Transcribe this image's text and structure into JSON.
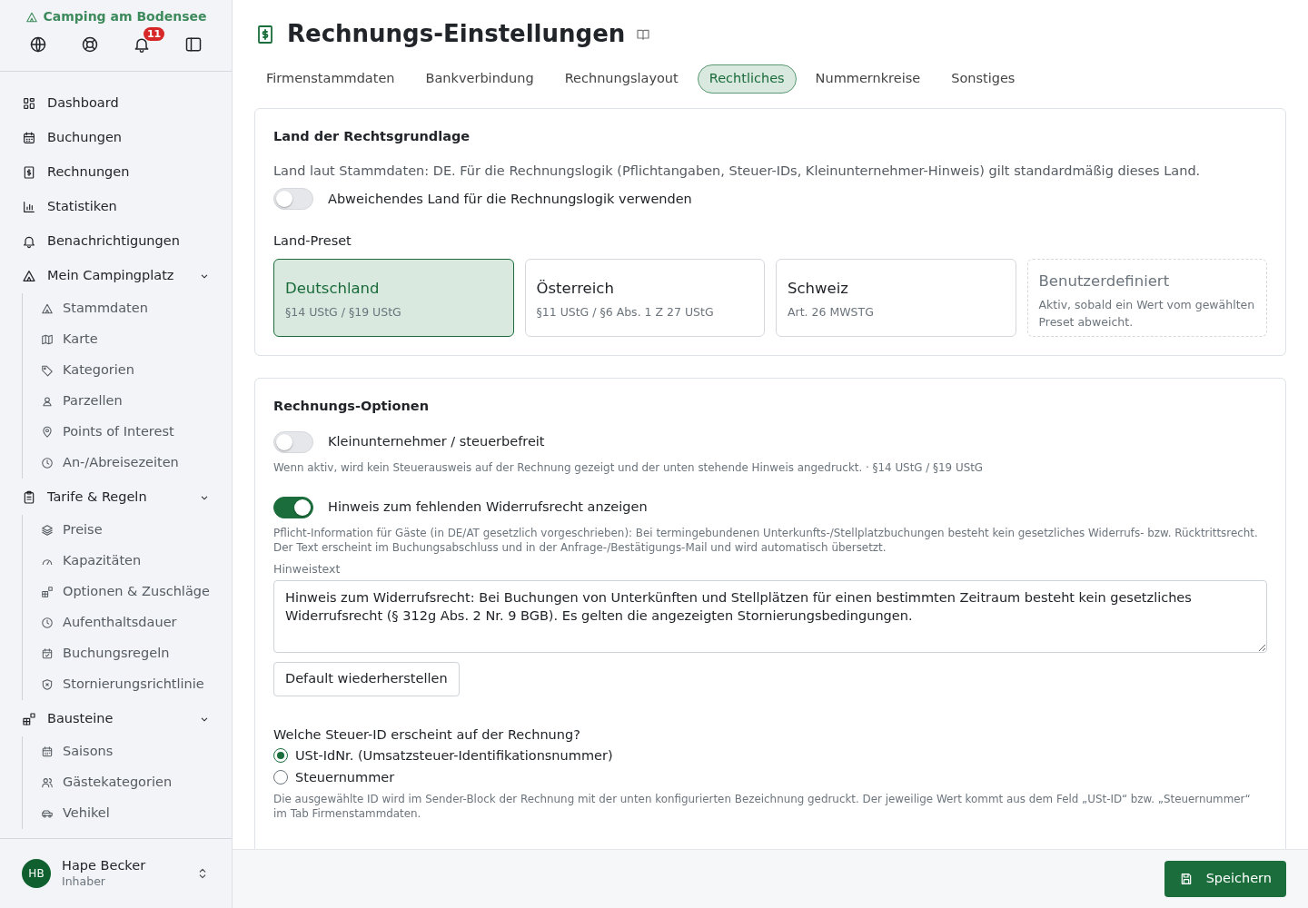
{
  "sidebar": {
    "brand": "Camping am Bodensee",
    "notification_count": "11",
    "items": [
      {
        "label": "Dashboard"
      },
      {
        "label": "Buchungen"
      },
      {
        "label": "Rechnungen"
      },
      {
        "label": "Statistiken"
      },
      {
        "label": "Benachrichtigungen"
      },
      {
        "label": "Mein Campingplatz",
        "expanded": true,
        "children": [
          {
            "label": "Stammdaten"
          },
          {
            "label": "Karte"
          },
          {
            "label": "Kategorien"
          },
          {
            "label": "Parzellen"
          },
          {
            "label": "Points of Interest"
          },
          {
            "label": "An-/Abreisezeiten"
          }
        ]
      },
      {
        "label": "Tarife & Regeln",
        "expanded": true,
        "children": [
          {
            "label": "Preise"
          },
          {
            "label": "Kapazitäten"
          },
          {
            "label": "Optionen & Zuschläge"
          },
          {
            "label": "Aufenthaltsdauer"
          },
          {
            "label": "Buchungsregeln"
          },
          {
            "label": "Stornierungsrichtlinie"
          }
        ]
      },
      {
        "label": "Bausteine",
        "expanded": true,
        "children": [
          {
            "label": "Saisons"
          },
          {
            "label": "Gästekategorien"
          },
          {
            "label": "Vehikel"
          }
        ]
      }
    ],
    "user": {
      "initials": "HB",
      "name": "Hape Becker",
      "role": "Inhaber"
    }
  },
  "page": {
    "title": "Rechnungs-Einstellungen"
  },
  "tabs": [
    {
      "label": "Firmenstammdaten",
      "selected": false
    },
    {
      "label": "Bankverbindung",
      "selected": false
    },
    {
      "label": "Rechnungslayout",
      "selected": false
    },
    {
      "label": "Rechtliches",
      "selected": true
    },
    {
      "label": "Nummernkreise",
      "selected": false
    },
    {
      "label": "Sonstiges",
      "selected": false
    }
  ],
  "country_card": {
    "title": "Land der Rechtsgrundlage",
    "description": "Land laut Stammdaten: DE. Für die Rechnungslogik (Pflichtangaben, Steuer-IDs, Kleinunternehmer-Hinweis) gilt standardmäßig dieses Land.",
    "override_toggle": {
      "label": "Abweichendes Land für die Rechnungslogik verwenden",
      "on": false
    },
    "preset_label": "Land-Preset",
    "presets": [
      {
        "kind": "country",
        "name": "Deutschland",
        "detail": "§14 UStG / §19 UStG",
        "selected": true
      },
      {
        "kind": "country",
        "name": "Österreich",
        "detail": "§11 UStG / §6 Abs. 1 Z 27 UStG",
        "selected": false
      },
      {
        "kind": "country",
        "name": "Schweiz",
        "detail": "Art. 26 MWSTG",
        "selected": false
      },
      {
        "kind": "custom",
        "name": "Benutzerdefiniert",
        "detail": "Aktiv, sobald ein Wert vom gewählten Preset abweicht.",
        "selected": false
      }
    ]
  },
  "options_card": {
    "title": "Rechnungs-Optionen",
    "toggles": [
      {
        "label": "Kleinunternehmer / steuerbefreit",
        "on": false,
        "hint": "Wenn aktiv, wird kein Steuerausweis auf der Rechnung gezeigt und der unten stehende Hinweis angedruckt. · §14 UStG / §19 UStG"
      },
      {
        "label": "Hinweis zum fehlenden Widerrufsrecht anzeigen",
        "on": true,
        "hint": "Pflicht-Information für Gäste (in DE/AT gesetzlich vorgeschrieben): Bei termingebundenen Unterkunfts-/Stellplatzbuchungen besteht kein gesetzliches Widerrufs- bzw. Rücktrittsrecht. Der Text erscheint im Buchungsabschluss und in der Anfrage-/Bestätigungs-Mail und wird automatisch übersetzt."
      }
    ],
    "notice_label": "Hinweistext",
    "notice_value": "Hinweis zum Widerrufsrecht: Bei Buchungen von Unterkünften und Stellplätzen für einen bestimmten Zeitraum besteht kein gesetzliches Widerrufsrecht (§ 312g Abs. 2 Nr. 9 BGB). Es gelten die angezeigten Stornierungsbedingungen.",
    "reset_button": "Default wiederherstellen",
    "tax_id_question": "Welche Steuer-ID erscheint auf der Rechnung?",
    "tax_id_options": [
      {
        "label": "USt-IdNr. (Umsatzsteuer-Identifikationsnummer)",
        "selected": true
      },
      {
        "label": "Steuernummer",
        "selected": false
      }
    ],
    "tax_id_hint": "Die ausgewählte ID wird im Sender-Block der Rechnung mit der unten konfigurierten Bezeichnung gedruckt. Der jeweilige Wert kommt aus dem Feld „USt-ID“ bzw. „Steuernummer“ im Tab Firmenstammdaten."
  },
  "footer": {
    "save_button": "Speichern"
  }
}
